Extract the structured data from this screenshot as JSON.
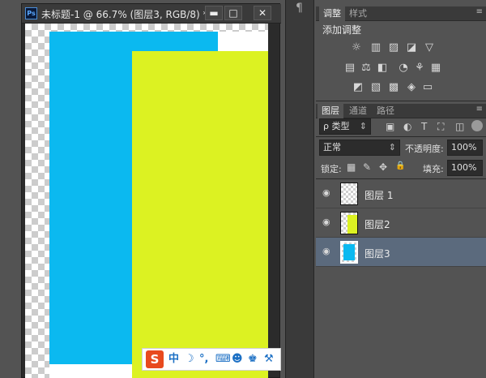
{
  "document": {
    "ps_badge": "Ps",
    "title": "未标题-1 @ 66.7% (图层3, RGB/8) *",
    "controls": {
      "minimize": "▬",
      "maximize": "□",
      "close": "✕"
    }
  },
  "ime_toolbar": {
    "logo": "S",
    "mode": "中",
    "moon": "☽",
    "punct": "°,",
    "keyboard": "⌨",
    "user": "☻",
    "shirt": "♚",
    "settings": "⚒"
  },
  "mid_strip": {
    "paragraph_icon": "¶"
  },
  "adjustments_panel": {
    "tabs": [
      "调整",
      "样式"
    ],
    "menu_icon": "≡",
    "title": "添加调整",
    "row1": [
      "☼",
      "▥",
      "▨",
      "◪",
      "▽"
    ],
    "row2": [
      "▤",
      "⚖",
      "◧",
      "◔",
      "⚘",
      "▦"
    ],
    "row3": [
      "◩",
      "▧",
      "▩",
      "◈",
      "▭"
    ]
  },
  "layers_panel": {
    "tabs": [
      "图层",
      "通道",
      "路径"
    ],
    "menu_icon": "≡",
    "filter_label": "ρ 类型",
    "filter_icons": [
      "▣",
      "◐",
      "T",
      "⛶",
      "◫"
    ],
    "blend_mode": "正常",
    "opacity_label": "不透明度:",
    "opacity_value": "100%",
    "lock_label": "锁定:",
    "lock_icons": [
      "▦",
      "✎",
      "✥",
      "🔒"
    ],
    "fill_label": "填充:",
    "fill_value": "100%",
    "layers": [
      {
        "name": "图层 1",
        "visible_icon": "◉"
      },
      {
        "name": "图层2",
        "visible_icon": "◉"
      },
      {
        "name": "图层3",
        "visible_icon": "◉"
      }
    ]
  },
  "colors": {
    "blue_layer": "#0bb9f0",
    "yellow_layer": "#dcf222",
    "selected_row": "#5b6a7d"
  }
}
